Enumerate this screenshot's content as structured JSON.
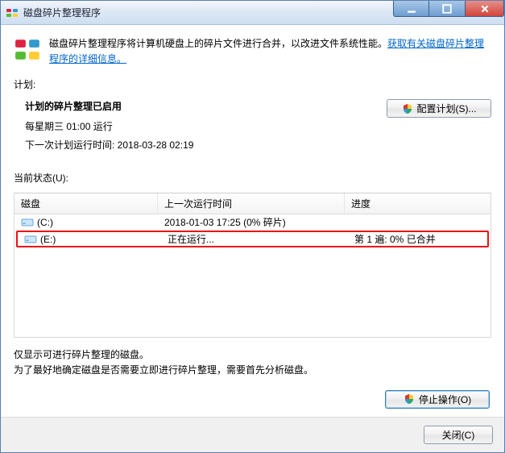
{
  "window": {
    "title": "磁盘碎片整理程序"
  },
  "info": {
    "text_before_link": "磁盘碎片整理程序将计算机硬盘上的碎片文件进行合并，以改进文件系统性能。",
    "link": "获取有关磁盘碎片整理程序的详细信息。"
  },
  "schedule": {
    "section_label": "计划:",
    "heading": "计划的碎片整理已启用",
    "freq": "每星期三   01:00 运行",
    "next": "下一次计划运行时间: 2018-03-28 02:19",
    "config_button": "配置计划(S)..."
  },
  "status": {
    "section_label": "当前状态(U):",
    "cols": {
      "disk": "磁盘",
      "last": "上一次运行时间",
      "progress": "进度"
    },
    "rows": [
      {
        "drive": "(C:)",
        "last": "2018-01-03 17:25 (0% 碎片)",
        "progress": "",
        "highlight": false
      },
      {
        "drive": "(E:)",
        "last": "正在运行...",
        "progress": "第 1 遍: 0% 已合并",
        "highlight": true
      }
    ]
  },
  "notes": {
    "line1": "仅显示可进行碎片整理的磁盘。",
    "line2": "为了最好地确定磁盘是否需要立即进行碎片整理，需要首先分析磁盘。"
  },
  "buttons": {
    "stop": "停止操作(O)",
    "close": "关闭(C)"
  }
}
